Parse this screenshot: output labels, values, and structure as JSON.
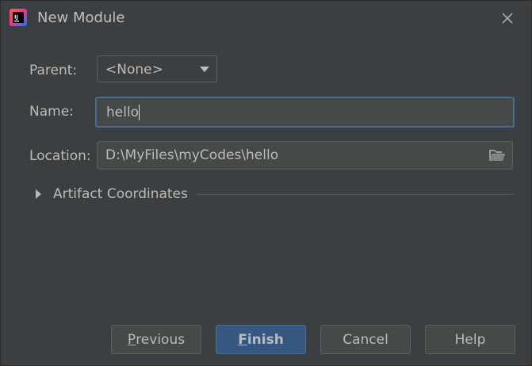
{
  "window": {
    "title": "New Module",
    "app_icon_text": "IJ"
  },
  "form": {
    "parent_label": "Parent:",
    "parent_value": "<None>",
    "name_label": "Name:",
    "name_value": "hello",
    "location_label": "Location:",
    "location_value": "D:\\MyFiles\\myCodes\\hello"
  },
  "artifact": {
    "label": "Artifact Coordinates",
    "expanded": false
  },
  "buttons": {
    "previous": {
      "mnemonic": "P",
      "rest": "revious"
    },
    "finish": {
      "mnemonic": "F",
      "rest": "inish"
    },
    "cancel": "Cancel",
    "help": "Help"
  },
  "colors": {
    "background": "#3c3f41",
    "default_button": "#365880",
    "focus_border": "#466d94"
  },
  "icons": {
    "app": "intellij-idea-icon",
    "close": "close-icon",
    "dropdown": "chevron-down-icon",
    "folder": "folder-icon",
    "expand": "chevron-right-icon"
  }
}
